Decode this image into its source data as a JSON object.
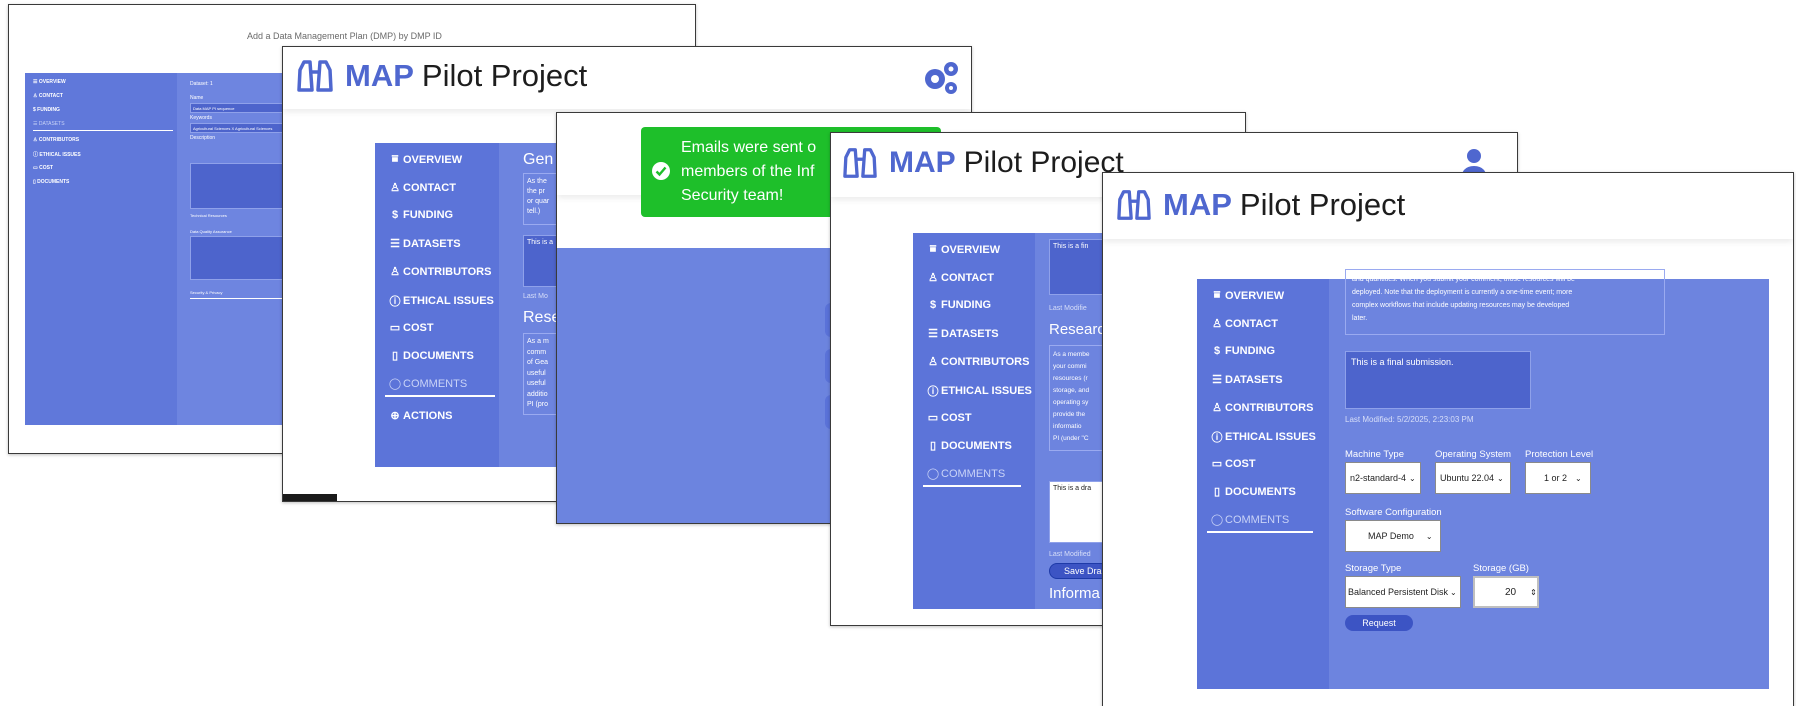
{
  "colors": {
    "accent": "#4f67cf",
    "panel": "#6d84df",
    "sidebar": "#5c74d9",
    "toast": "#1ebf2a"
  },
  "brand": {
    "map": "MAP",
    "rest": "Pilot Project",
    "icon": "binoculars-icon"
  },
  "shot1": {
    "title": "Add a Data Management Plan (DMP) by DMP ID",
    "nav": [
      "OVERVIEW",
      "CONTACT",
      "FUNDING",
      "DATASETS",
      "CONTRIBUTORS",
      "ETHICAL ISSUES",
      "COST",
      "DOCUMENTS"
    ],
    "fields": {
      "dataset": "Dataset: 1",
      "name_label": "Name",
      "name_value": "Data MAP PI sequence",
      "keywords_label": "Keywords",
      "keywords_value": "Agricultural Sciences X  Agricultural Sciences",
      "description_label": "Description",
      "technical": "Technical Resources",
      "quality": "Data Quality Assurance",
      "security": "Security & Privacy"
    }
  },
  "shot2": {
    "settings_icon": "gears-icon",
    "nav": [
      "OVERVIEW",
      "CONTACT",
      "FUNDING",
      "DATASETS",
      "CONTRIBUTORS",
      "ETHICAL ISSUES",
      "COST",
      "DOCUMENTS",
      "COMMENTS",
      "ACTIONS"
    ],
    "heading1": "Gen",
    "heading2": "Rese",
    "para1": [
      "As the",
      "the pr",
      "or quar",
      "tell.)"
    ],
    "box1": "This is a",
    "last_modified": "Last Mo",
    "para2": [
      "As a m",
      "comm",
      "of Gea",
      "useful",
      "useful",
      "additio",
      "PI (pro"
    ]
  },
  "shot3": {
    "toast": [
      "Emails were sent o",
      "members of the Inf",
      "Security team!"
    ],
    "toast_icon": "check-circle-icon"
  },
  "shot4": {
    "user_icon": "user-icon",
    "nav": [
      "OVERVIEW",
      "CONTACT",
      "FUNDING",
      "DATASETS",
      "CONTRIBUTORS",
      "ETHICAL ISSUES",
      "COST",
      "DOCUMENTS",
      "COMMENTS"
    ],
    "box1": "This is a fin",
    "last_modified1": "Last Modifie",
    "heading": "Researc",
    "para": [
      "As a membe",
      "your commi",
      "resources (r",
      "storage, and",
      "operating sy",
      "provide the",
      "informatio",
      "PI (under \"C"
    ],
    "box2": "This is a dra",
    "last_modified2": "Last Modified",
    "save_button": "Save Dra",
    "footer_heading": "Informa"
  },
  "shot5": {
    "nav": [
      "OVERVIEW",
      "CONTACT",
      "FUNDING",
      "DATASETS",
      "CONTRIBUTORS",
      "ETHICAL ISSUES",
      "COST",
      "DOCUMENTS",
      "COMMENTS"
    ],
    "intro": [
      "and quantities. When you submit your comment, those resources will be",
      "deployed. Note that the deployment is currently a one-time event; more",
      "complex workflows that include updating resources may be developed",
      "later."
    ],
    "submission": "This is a final submission.",
    "last_modified": "Last Modified: 5/2/2025, 2:23:03 PM",
    "machine_type_label": "Machine Type",
    "machine_type": "n2-standard-4",
    "os_label": "Operating System",
    "os": "Ubuntu 22.04",
    "protection_label": "Protection Level",
    "protection": "1 or 2",
    "software_label": "Software Configuration",
    "software": "MAP Demo",
    "storage_type_label": "Storage Type",
    "storage_type": "Balanced Persistent Disk",
    "storage_label": "Storage (GB)",
    "storage": "20",
    "request_button": "Request"
  }
}
